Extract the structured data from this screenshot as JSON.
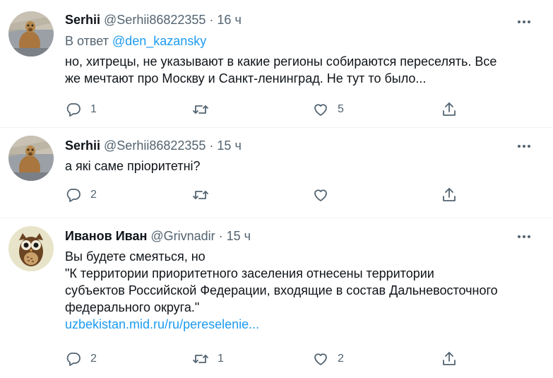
{
  "tweets": [
    {
      "name": "Serhii",
      "handle": "@Serhii86822355",
      "separator": "·",
      "time": "16 ч",
      "reply_prefix": "В ответ",
      "reply_mention": "@den_kazansky",
      "text_lines": [
        "но, хитрецы, не указывают в какие регионы собираются переселять. Все",
        "же мечтают про Москву и Санкт-ленинград. Не тут то было..."
      ],
      "link": "",
      "replies": "1",
      "retweets": "",
      "likes": "5",
      "avatar_icon": "meerkat-photo"
    },
    {
      "name": "Serhii",
      "handle": "@Serhii86822355",
      "separator": "·",
      "time": "15 ч",
      "text_lines": [
        "а які саме пріоритетні?"
      ],
      "link": "",
      "replies": "2",
      "retweets": "",
      "likes": "",
      "avatar_icon": "meerkat-photo"
    },
    {
      "name": "Иванов Иван",
      "handle": "@Grivnadir",
      "separator": "·",
      "time": "15 ч",
      "text_lines": [
        "Вы будете смеяться, но",
        "\"К территории приоритетного заселения отнесены территории",
        "субъектов Российской Федерации, входящие в состав Дальневосточного",
        "федерального округа.\""
      ],
      "link": "uzbekistan.mid.ru/ru/pereselenie...",
      "replies": "2",
      "retweets": "1",
      "likes": "2",
      "avatar_icon": "owl-illustration"
    }
  ],
  "icons": {
    "reply": "reply-icon",
    "retweet": "retweet-icon",
    "like": "heart-icon",
    "share": "share-icon",
    "more": "more-icon"
  },
  "colors": {
    "link": "#1d9bf0",
    "secondary_text": "#536471",
    "primary_text": "#0f1419"
  }
}
